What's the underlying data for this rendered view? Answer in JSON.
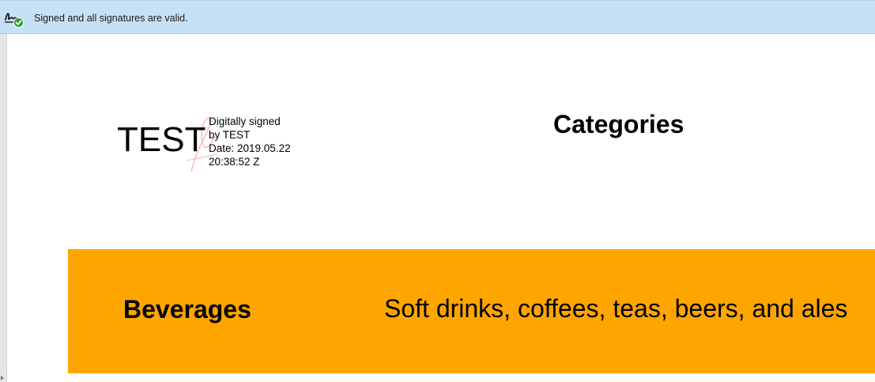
{
  "signature_bar": {
    "message": "Signed and all signatures are valid.",
    "icon": "signature-valid-icon",
    "background": "#c6e0f5"
  },
  "document": {
    "signature_block": {
      "name": "TEST",
      "details": [
        "Digitally signed",
        "by TEST",
        "Date: 2019.05.22",
        "20:38:52 Z"
      ]
    },
    "heading": "Categories",
    "rows": [
      {
        "name": "Beverages",
        "description": "Soft drinks, coffees, teas, beers, and ales",
        "background": "#ffa500"
      }
    ]
  }
}
